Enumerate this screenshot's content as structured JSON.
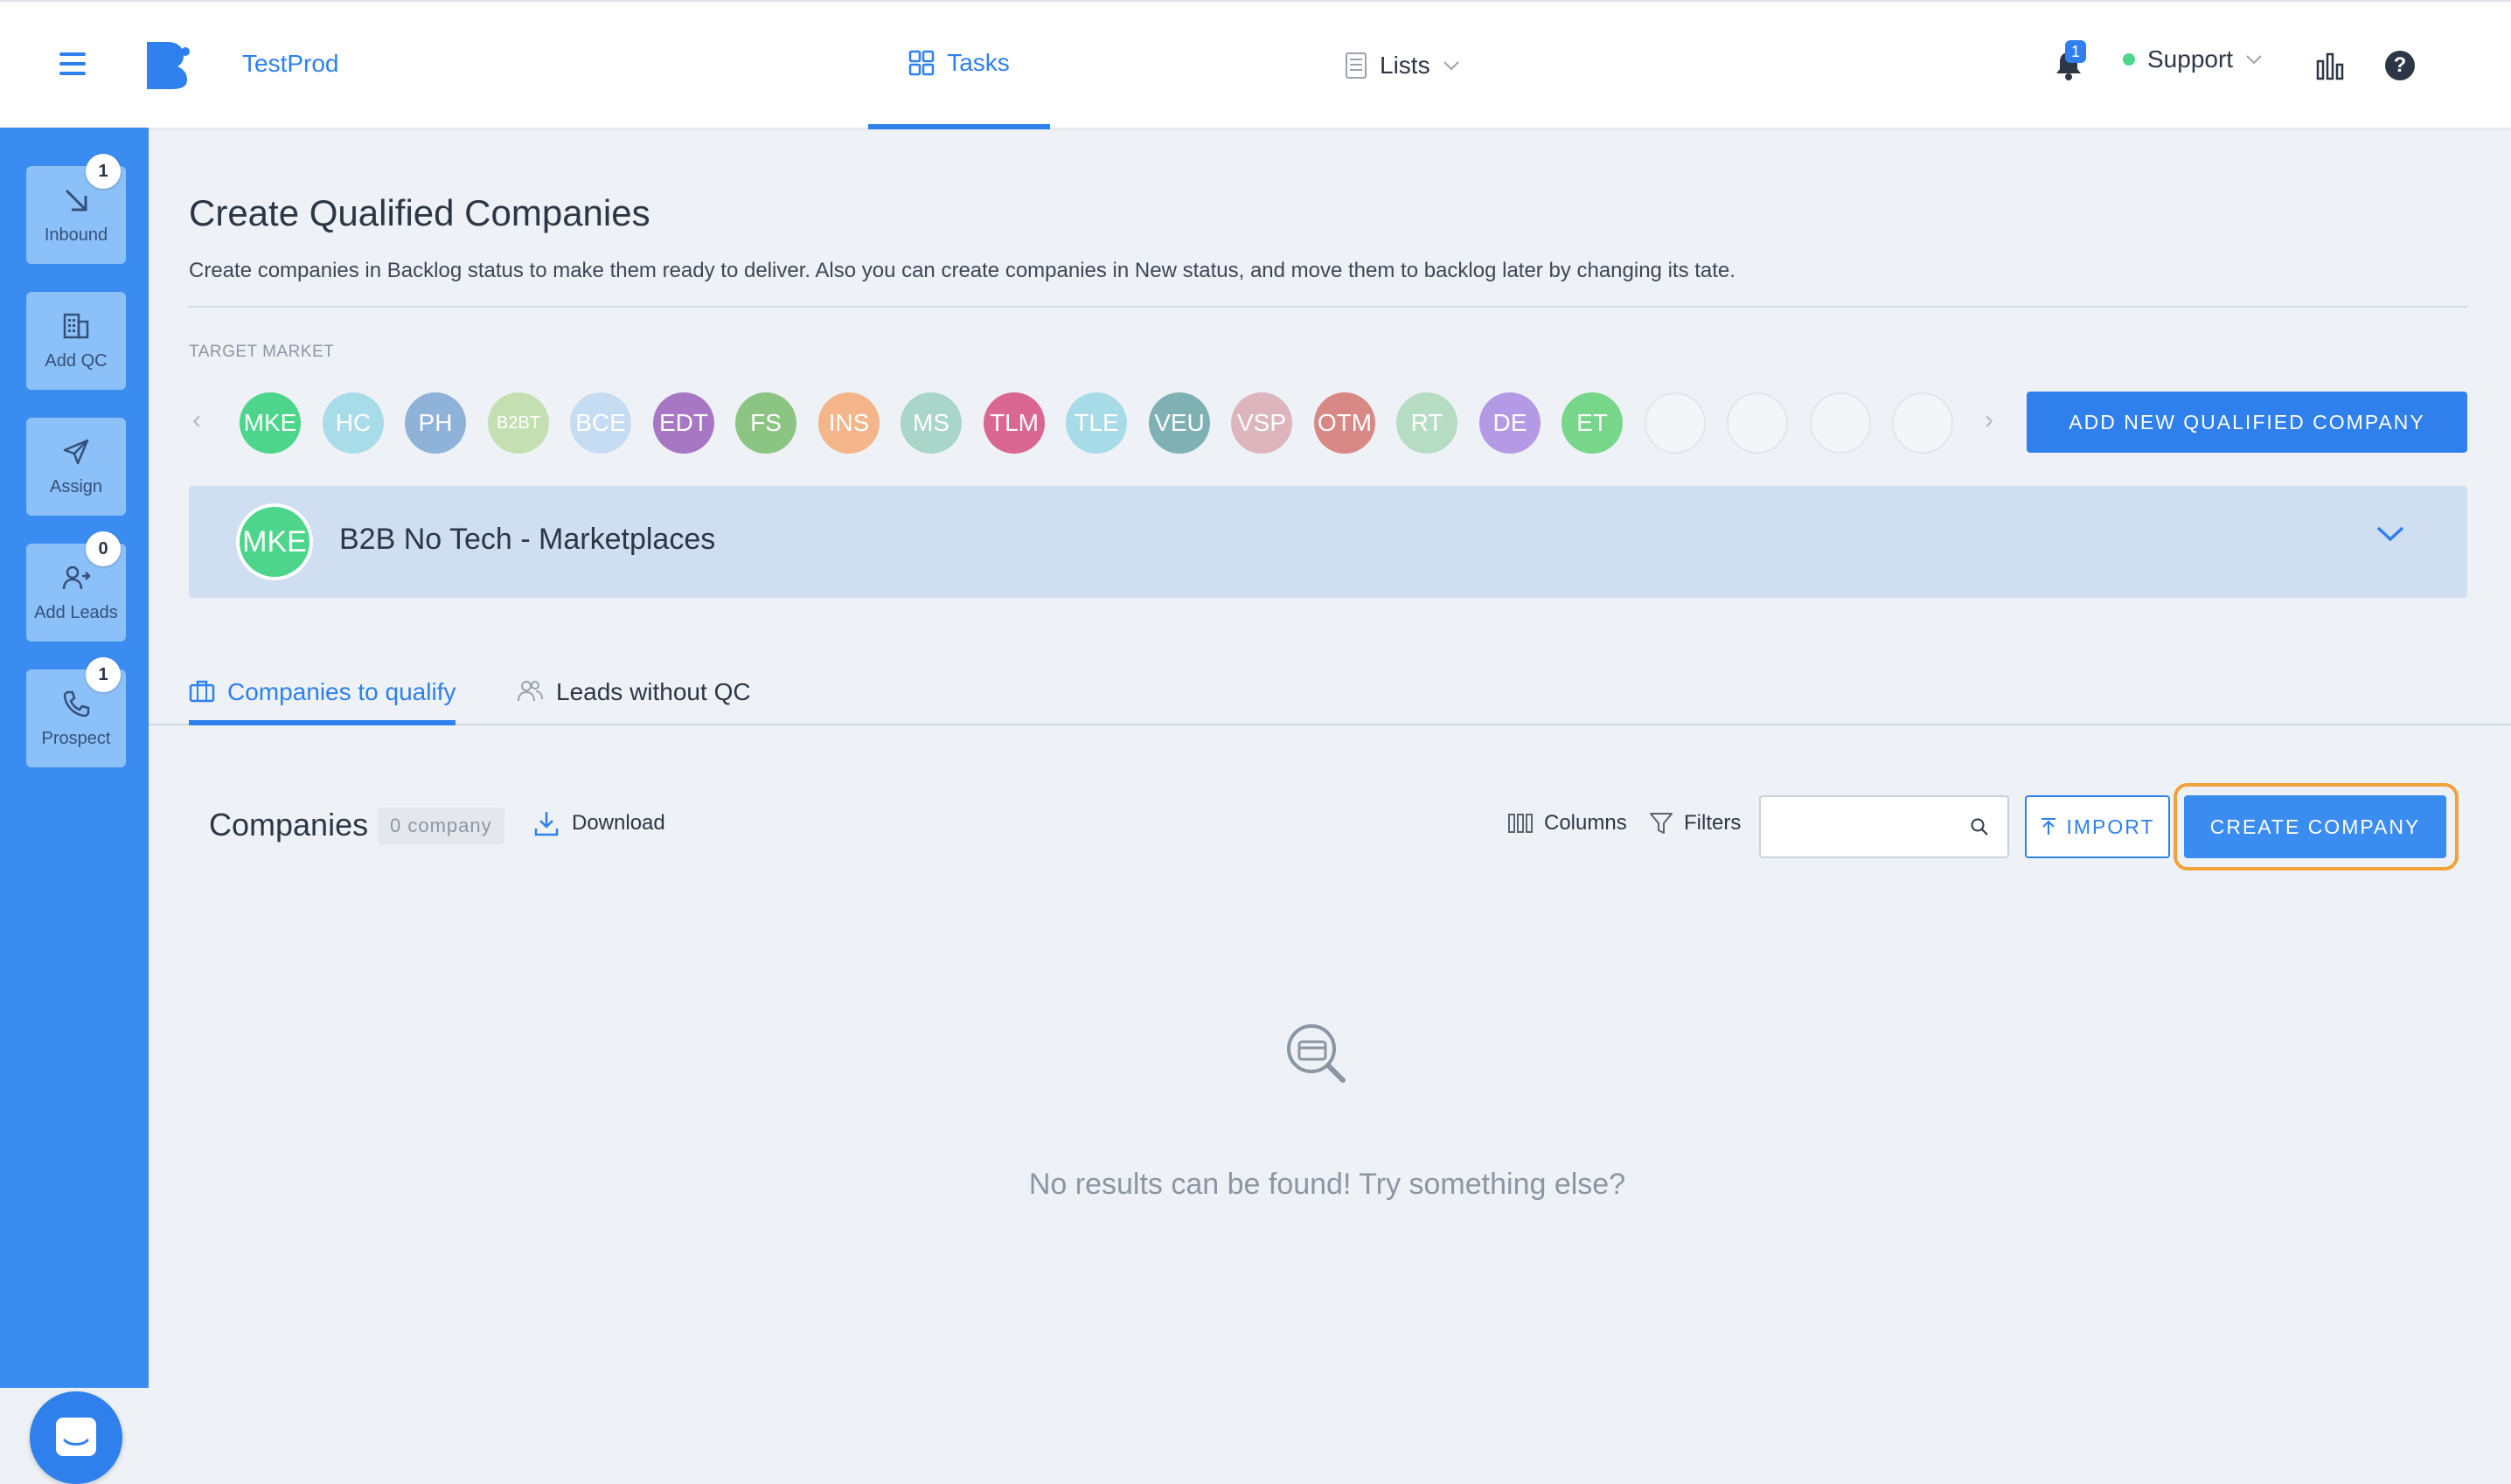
{
  "topbar": {
    "brand": "TestProd",
    "tasks_label": "Tasks",
    "lists_label": "Lists",
    "notification_count": "1",
    "support_label": "Support"
  },
  "sidebar": {
    "items": [
      {
        "label": "Inbound",
        "badge": "1"
      },
      {
        "label": "Add QC",
        "badge": ""
      },
      {
        "label": "Assign",
        "badge": ""
      },
      {
        "label": "Add Leads",
        "badge": "0"
      },
      {
        "label": "Prospect",
        "badge": "1"
      }
    ]
  },
  "header": {
    "title": "Create Qualified Companies",
    "description": "Create companies in Backlog status to make them ready to deliver. Also you can create companies in New status, and move them to backlog later by changing its tate.",
    "target_market_label": "TARGET MARKET",
    "add_button": "ADD NEW QUALIFIED COMPANY"
  },
  "target_markets": [
    {
      "code": "MKE",
      "color": "#4cd58b"
    },
    {
      "code": "HC",
      "color": "#a8dce8"
    },
    {
      "code": "PH",
      "color": "#8fb2d8"
    },
    {
      "code": "B2BT",
      "color": "#c4e0b3"
    },
    {
      "code": "BCE",
      "color": "#c6dcf2"
    },
    {
      "code": "EDT",
      "color": "#a777c4"
    },
    {
      "code": "FS",
      "color": "#8cc483"
    },
    {
      "code": "INS",
      "color": "#f3b589"
    },
    {
      "code": "MS",
      "color": "#a9d6c8"
    },
    {
      "code": "TLM",
      "color": "#d9678f"
    },
    {
      "code": "TLE",
      "color": "#a7dbe8"
    },
    {
      "code": "VEU",
      "color": "#7fb1b4"
    },
    {
      "code": "VSP",
      "color": "#ddb5bd"
    },
    {
      "code": "OTM",
      "color": "#d88986"
    },
    {
      "code": "RT",
      "color": "#b7dcc4"
    },
    {
      "code": "DE",
      "color": "#b49ae4"
    },
    {
      "code": "ET",
      "color": "#78d68a"
    }
  ],
  "selected_market": {
    "code": "MKE",
    "name": "B2B No Tech - Marketplaces"
  },
  "tabs": [
    {
      "label": "Companies to qualify"
    },
    {
      "label": "Leads without QC"
    }
  ],
  "companies": {
    "title": "Companies",
    "count": "0 company",
    "download": "Download",
    "columns": "Columns",
    "filters": "Filters",
    "search_placeholder": "",
    "import": "IMPORT",
    "create": "CREATE COMPANY",
    "empty_message": "No results can be found! Try something else?"
  }
}
